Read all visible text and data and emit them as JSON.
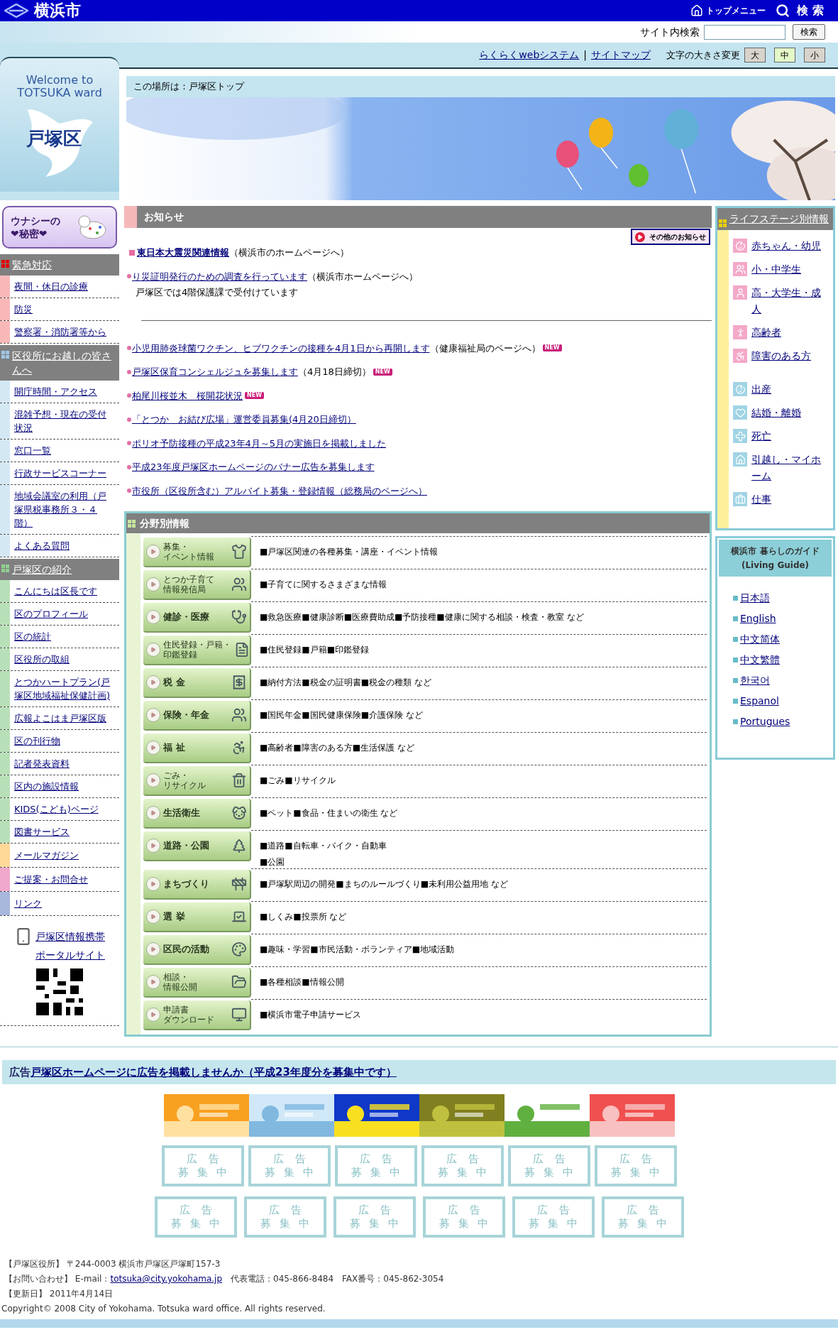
{
  "header": {
    "city": "横浜市",
    "top_menu": "トップメニュー",
    "search_label": "検 索"
  },
  "site_search": {
    "label": "サイト内検索",
    "button": "検索"
  },
  "utility": {
    "links": [
      "らくらくwebシステム",
      "サイトマップ"
    ],
    "separator": "|",
    "font_size_label": "文字の大きさ変更",
    "font_sizes": [
      {
        "label": "大",
        "selected": false
      },
      {
        "label": "中",
        "selected": true
      },
      {
        "label": "小",
        "selected": false
      }
    ]
  },
  "logo": {
    "welcome": [
      "Welcome to",
      "TOTSUKA ward"
    ],
    "ward": "戸塚区"
  },
  "breadcrumb": "この場所は：戸塚区トップ",
  "left_nav": {
    "feature": [
      "ウナシーの",
      "❤秘密❤"
    ],
    "blocks": [
      {
        "kind": "section",
        "title": "緊急対応",
        "icon": {
          "color": "#e00000"
        },
        "color": "#f8b8b8",
        "items": [
          "夜間・休日の診療",
          "防災",
          "警察署・消防署等から"
        ]
      },
      {
        "kind": "section",
        "title": "区役所にお越しの皆さんへ",
        "icon": {
          "color": "#a0c8e8"
        },
        "color": "#d4e8f4",
        "items": [
          "開庁時間・アクセス",
          "混雑予想・現在の受付状況",
          "窓口一覧",
          "行政サービスコーナー",
          "地域会議室の利用（戸塚県税事務所３・４階）",
          "よくある質問"
        ]
      },
      {
        "kind": "section",
        "title": "戸塚区の紹介",
        "icon": {
          "color": "#90d090"
        },
        "color": "#b8e0b8",
        "items": [
          "こんにちは区長です",
          "区のプロフィール",
          "区の統計",
          "区役所の取組",
          "とつかハートプラン(戸塚区地域福祉保健計画)",
          "広報よこはま戸塚区版",
          "区の刊行物",
          "記者発表資料",
          "区内の施設情報",
          "KIDS(こども)ページ",
          "図書サービス"
        ]
      },
      {
        "kind": "link",
        "label": "メールマガジン",
        "color": "#ffd898"
      },
      {
        "kind": "link",
        "label": "ご提案・お問合せ",
        "color": "#f0a8cc"
      },
      {
        "kind": "link",
        "label": "リンク",
        "color": "#a8b8dc"
      }
    ],
    "mobile": [
      "戸塚区情報携帯",
      "ポータルサイト"
    ]
  },
  "news": {
    "title": "お知らせ",
    "more": "その他のお知らせ",
    "items": [
      {
        "kind": "square",
        "link": "東日本大震災関連情報",
        "note": "（横浜市のホームページへ）"
      },
      {
        "kind": "dot",
        "link": "り災証明発行のための調査を行っています",
        "note": "（横浜市ホームページへ）",
        "sub": "戸塚区では4階保護課で受付けています"
      },
      {
        "kind": "divider"
      },
      {
        "kind": "dot",
        "link": "小児用肺炎球菌ワクチン、ヒブワクチンの接種を4月1日から再開します",
        "note": "（健康福祉局のページへ）",
        "badge": "NEW"
      },
      {
        "kind": "dot",
        "link": "戸塚区保育コンシェルジュを募集します",
        "note": "（4月18日締切）",
        "badge": "NEW"
      },
      {
        "kind": "dot",
        "link": "柏尾川桜並木　桜開花状況",
        "badge": "NEW"
      },
      {
        "kind": "dot",
        "link": "「とつか　お結び広場」運営委員募集(4月20日締切）"
      },
      {
        "kind": "dot",
        "link": "ポリオ予防接種の平成23年4月～5月の実施日を掲載しました"
      },
      {
        "kind": "dot",
        "link": "平成23年度戸塚区ホームページのバナー広告を募集します"
      },
      {
        "kind": "dot",
        "link": "市役所（区役所含む）アルバイト募集・登録情報（総務局のページへ）"
      }
    ]
  },
  "categories": {
    "title": "分野別情報",
    "rows": [
      {
        "label": [
          "募集・",
          "イベント情報"
        ],
        "lines": [
          "■戸塚区関連の各種募集・講座・イベント情報"
        ]
      },
      {
        "label": [
          "とつか子育て",
          "情報発信局"
        ],
        "lines": [
          "■子育てに関するさまざまな情報"
        ]
      },
      {
        "label": [
          "健診・医療"
        ],
        "lines": [
          "■救急医療■健康診断■医療費助成■予防接種■健康に関する相談・検査・教室 など"
        ]
      },
      {
        "label": [
          "住民登録・戸籍・",
          "印鑑登録"
        ],
        "lines": [
          "■住民登録■戸籍■印鑑登録"
        ]
      },
      {
        "label": [
          "税 金"
        ],
        "lines": [
          "■納付方法■税金の証明書■税金の種類 など"
        ]
      },
      {
        "label": [
          "保険・年金"
        ],
        "lines": [
          "■国民年金■国民健康保険■介護保険 など"
        ]
      },
      {
        "label": [
          "福 祉"
        ],
        "lines": [
          "■高齢者■障害のある方■生活保護 など"
        ]
      },
      {
        "label": [
          "ごみ・",
          "リサイクル"
        ],
        "lines": [
          "■ごみ■リサイクル"
        ]
      },
      {
        "label": [
          "生活衛生"
        ],
        "lines": [
          "■ペット■食品・住まいの衛生 など"
        ]
      },
      {
        "label": [
          "道路・公園"
        ],
        "lines": [
          "■道路■自転車・バイク・自動車",
          "■公園"
        ]
      },
      {
        "label": [
          "まちづくり"
        ],
        "lines": [
          "■戸塚駅周辺の開発■まちのルールづくり■未利用公益用地 など"
        ]
      },
      {
        "label": [
          "選 挙"
        ],
        "lines": [
          "■しくみ■投票所 など"
        ]
      },
      {
        "label": [
          "区民の活動"
        ],
        "lines": [
          "■趣味・学習■市民活動・ボランティア■地域活動"
        ]
      },
      {
        "label": [
          "相談・",
          "情報公開"
        ],
        "lines": [
          "■各種相談■情報公開"
        ]
      },
      {
        "label": [
          "申請書",
          "ダウンロード"
        ],
        "lines": [
          "■横浜市電子申請サービス"
        ]
      }
    ]
  },
  "life_stage": {
    "title": "ライフステージ別情報",
    "items": [
      {
        "label": "赤ちゃん・幼児",
        "color": "#f4a8c8"
      },
      {
        "label": "小・中学生",
        "color": "#f4a8c8"
      },
      {
        "label": "高・大学生・成人",
        "color": "#f4a8c8"
      },
      {
        "label": "高齢者",
        "color": "#f4a8c8"
      },
      {
        "label": "障害のある方",
        "color": "#f4a8c8"
      },
      {
        "label": "出産",
        "color": "#a0d4e4"
      },
      {
        "label": "結婚・離婚",
        "color": "#a0d4e4"
      },
      {
        "label": "死亡",
        "color": "#a0d4e4"
      },
      {
        "label": "引越し・マイホーム",
        "color": "#a0d4e4"
      },
      {
        "label": "仕事",
        "color": "#a0d4e4"
      }
    ]
  },
  "living_guide": {
    "title": [
      "横浜市 暮らしのガイド",
      "(Living Guide)"
    ],
    "links": [
      "日本語",
      "English",
      "中文简体",
      "中文繁體",
      "한국어",
      "Espanol",
      "Portugues"
    ]
  },
  "ads": {
    "label": "広告",
    "link": "戸塚区ホームページに広告を掲載しませんか（平成23年度分を募集中です）",
    "banners": [
      {
        "kind": "picture"
      },
      {
        "kind": "picture"
      },
      {
        "kind": "picture"
      },
      {
        "kind": "picture"
      },
      {
        "kind": "picture"
      },
      {
        "kind": "picture"
      }
    ],
    "vacancy_rows": [
      [
        {
          "top": "広告",
          "bottom": "募集中"
        },
        {
          "top": "広告",
          "bottom": "募集中"
        },
        {
          "top": "広告",
          "bottom": "募集中"
        },
        {
          "top": "広告",
          "bottom": "募集中"
        },
        {
          "top": "広告",
          "bottom": "募集中"
        },
        {
          "top": "広告",
          "bottom": "募集中"
        }
      ],
      [
        {
          "top": "広告",
          "bottom": "募集中"
        },
        {
          "top": "広告",
          "bottom": "募集中"
        },
        {
          "top": "広告",
          "bottom": "募集中"
        },
        {
          "top": "広告",
          "bottom": "募集中"
        },
        {
          "top": "広告",
          "bottom": "募集中"
        },
        {
          "top": "広告",
          "bottom": "募集中"
        }
      ]
    ]
  },
  "footer": {
    "address": "【戸塚区役所】 〒244-0003 横浜市戸塚区戸塚町157-3",
    "contact_label": "【お問い合わせ】 E-mail：",
    "email": "totsuka@city.yokohama.jp",
    "phones": "　代表電話：045-866-8484　FAX番号：045-862-3054",
    "updated": "【更新日】 2011年4月14日",
    "copyright": "Copyright© 2008 City of Yokohama. Totsuka ward office. All rights reserved."
  }
}
